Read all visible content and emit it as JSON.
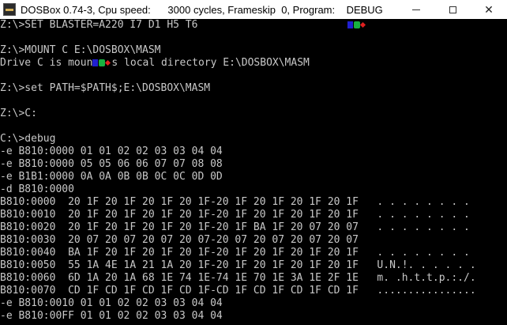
{
  "window": {
    "title": "DOSBox 0.74-3, Cpu speed:      3000 cycles, Frameskip  0, Program:    DEBUG"
  },
  "console": {
    "lines": [
      "Z:\\>SET BLASTER=A220 I7 D1 H5 T6",
      "",
      "Z:\\>MOUNT C E:\\DOSBOX\\MASM",
      "Drive C is moun",
      "",
      "Z:\\>set PATH=$PATH$;E:\\DOSBOX\\MASM",
      "",
      "Z:\\>C:",
      "",
      "C:\\>debug",
      "-e B810:0000 01 01 02 02 03 03 04 04",
      "-e B810:0000 05 05 06 06 07 07 08 08",
      "-e B1B1:0000 0A 0A 0B 0B 0C 0C 0D 0D",
      "-d B810:0000",
      "B810:0000  20 1F 20 1F 20 1F 20 1F-20 1F 20 1F 20 1F 20 1F   . . . . . . . .",
      "B810:0010  20 1F 20 1F 20 1F 20 1F-20 1F 20 1F 20 1F 20 1F   . . . . . . . .",
      "B810:0020  20 1F 20 1F 20 1F 20 1F-20 1F BA 1F 20 07 20 07   . . . . . . . .",
      "B810:0030  20 07 20 07 20 07 20 07-20 07 20 07 20 07 20 07",
      "B810:0040  BA 1F 20 1F 20 1F 20 1F-20 1F 20 1F 20 1F 20 1F   . . . . . . . .",
      "B810:0050  55 1A 4E 1A 21 1A 20 1F-20 1F 20 1F 20 1F 20 1F   U.N.!. . . . . .",
      "B810:0060  6D 1A 20 1A 68 1E 74 1E-74 1E 70 1E 3A 1E 2F 1E   m. .h.t.t.p.:./.",
      "B810:0070  CD 1F CD 1F CD 1F CD 1F-CD 1F CD 1F CD 1F CD 1F   ................",
      "-e B810:0010 01 01 02 02 03 03 04 04",
      "-e B810:00FF 01 01 02 02 03 03 04 04"
    ],
    "line3_tail": "s local directory E:\\DOSBOX\\MASM"
  },
  "colors": {
    "console_bg": "#000000",
    "console_text": "#c8c8c8",
    "titlebar_bg": "#ffffff"
  },
  "icons": {
    "app": "dosbox-icon",
    "minimize": "minimize-icon",
    "maximize": "maximize-icon",
    "close": "close-icon"
  }
}
